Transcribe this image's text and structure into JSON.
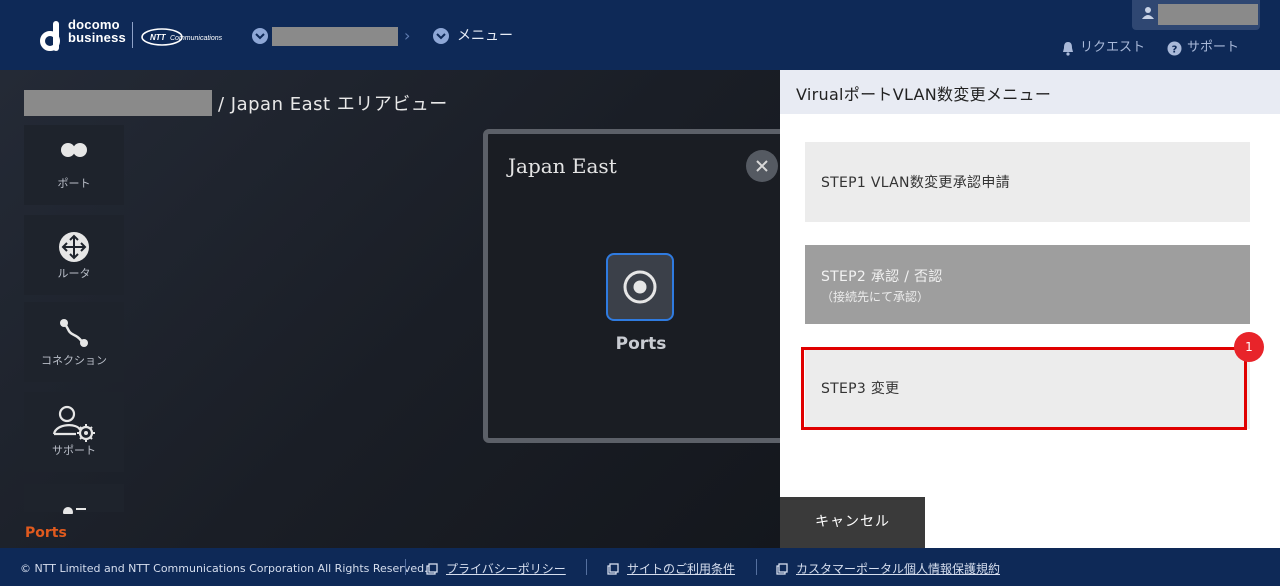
{
  "header": {
    "logo_line1": "docomo",
    "logo_line2": "business",
    "partner_logo": "NTT Communications",
    "breadcrumb_menu": "メニュー",
    "request_label": "リクエスト",
    "support_label": "サポート"
  },
  "main": {
    "page_title": "/ Japan East エリアビュー",
    "sidebar": [
      {
        "label": "ポート",
        "icon": "port-icon"
      },
      {
        "label": "ルータ",
        "icon": "router-icon"
      },
      {
        "label": "コネクション",
        "icon": "connection-icon"
      },
      {
        "label": "サポート",
        "icon": "support-icon"
      }
    ],
    "active_section": "Ports",
    "region_card": {
      "title": "Japan East",
      "port_label": "Ports"
    }
  },
  "panel": {
    "title": "VirualポートVLAN数変更メニュー",
    "steps": [
      {
        "label": "STEP1 VLAN数変更承認申請"
      },
      {
        "label": "STEP2 承認 / 否認",
        "sub": "（接続先にて承認）"
      },
      {
        "label": "STEP3 変更"
      }
    ],
    "highlight_badge": "1",
    "cancel_label": "キャンセル"
  },
  "footer": {
    "copyright": "© NTT Limited and NTT Communications Corporation All Rights Reserved.",
    "links": [
      "プライバシーポリシー",
      "サイトのご利用条件",
      "カスタマーポータル個人情報保護規約"
    ]
  },
  "colors": {
    "header_bg": "#0e2957",
    "accent_orange": "#e05a1e",
    "highlight_red": "#e00000",
    "port_border_blue": "#2f7be0"
  }
}
